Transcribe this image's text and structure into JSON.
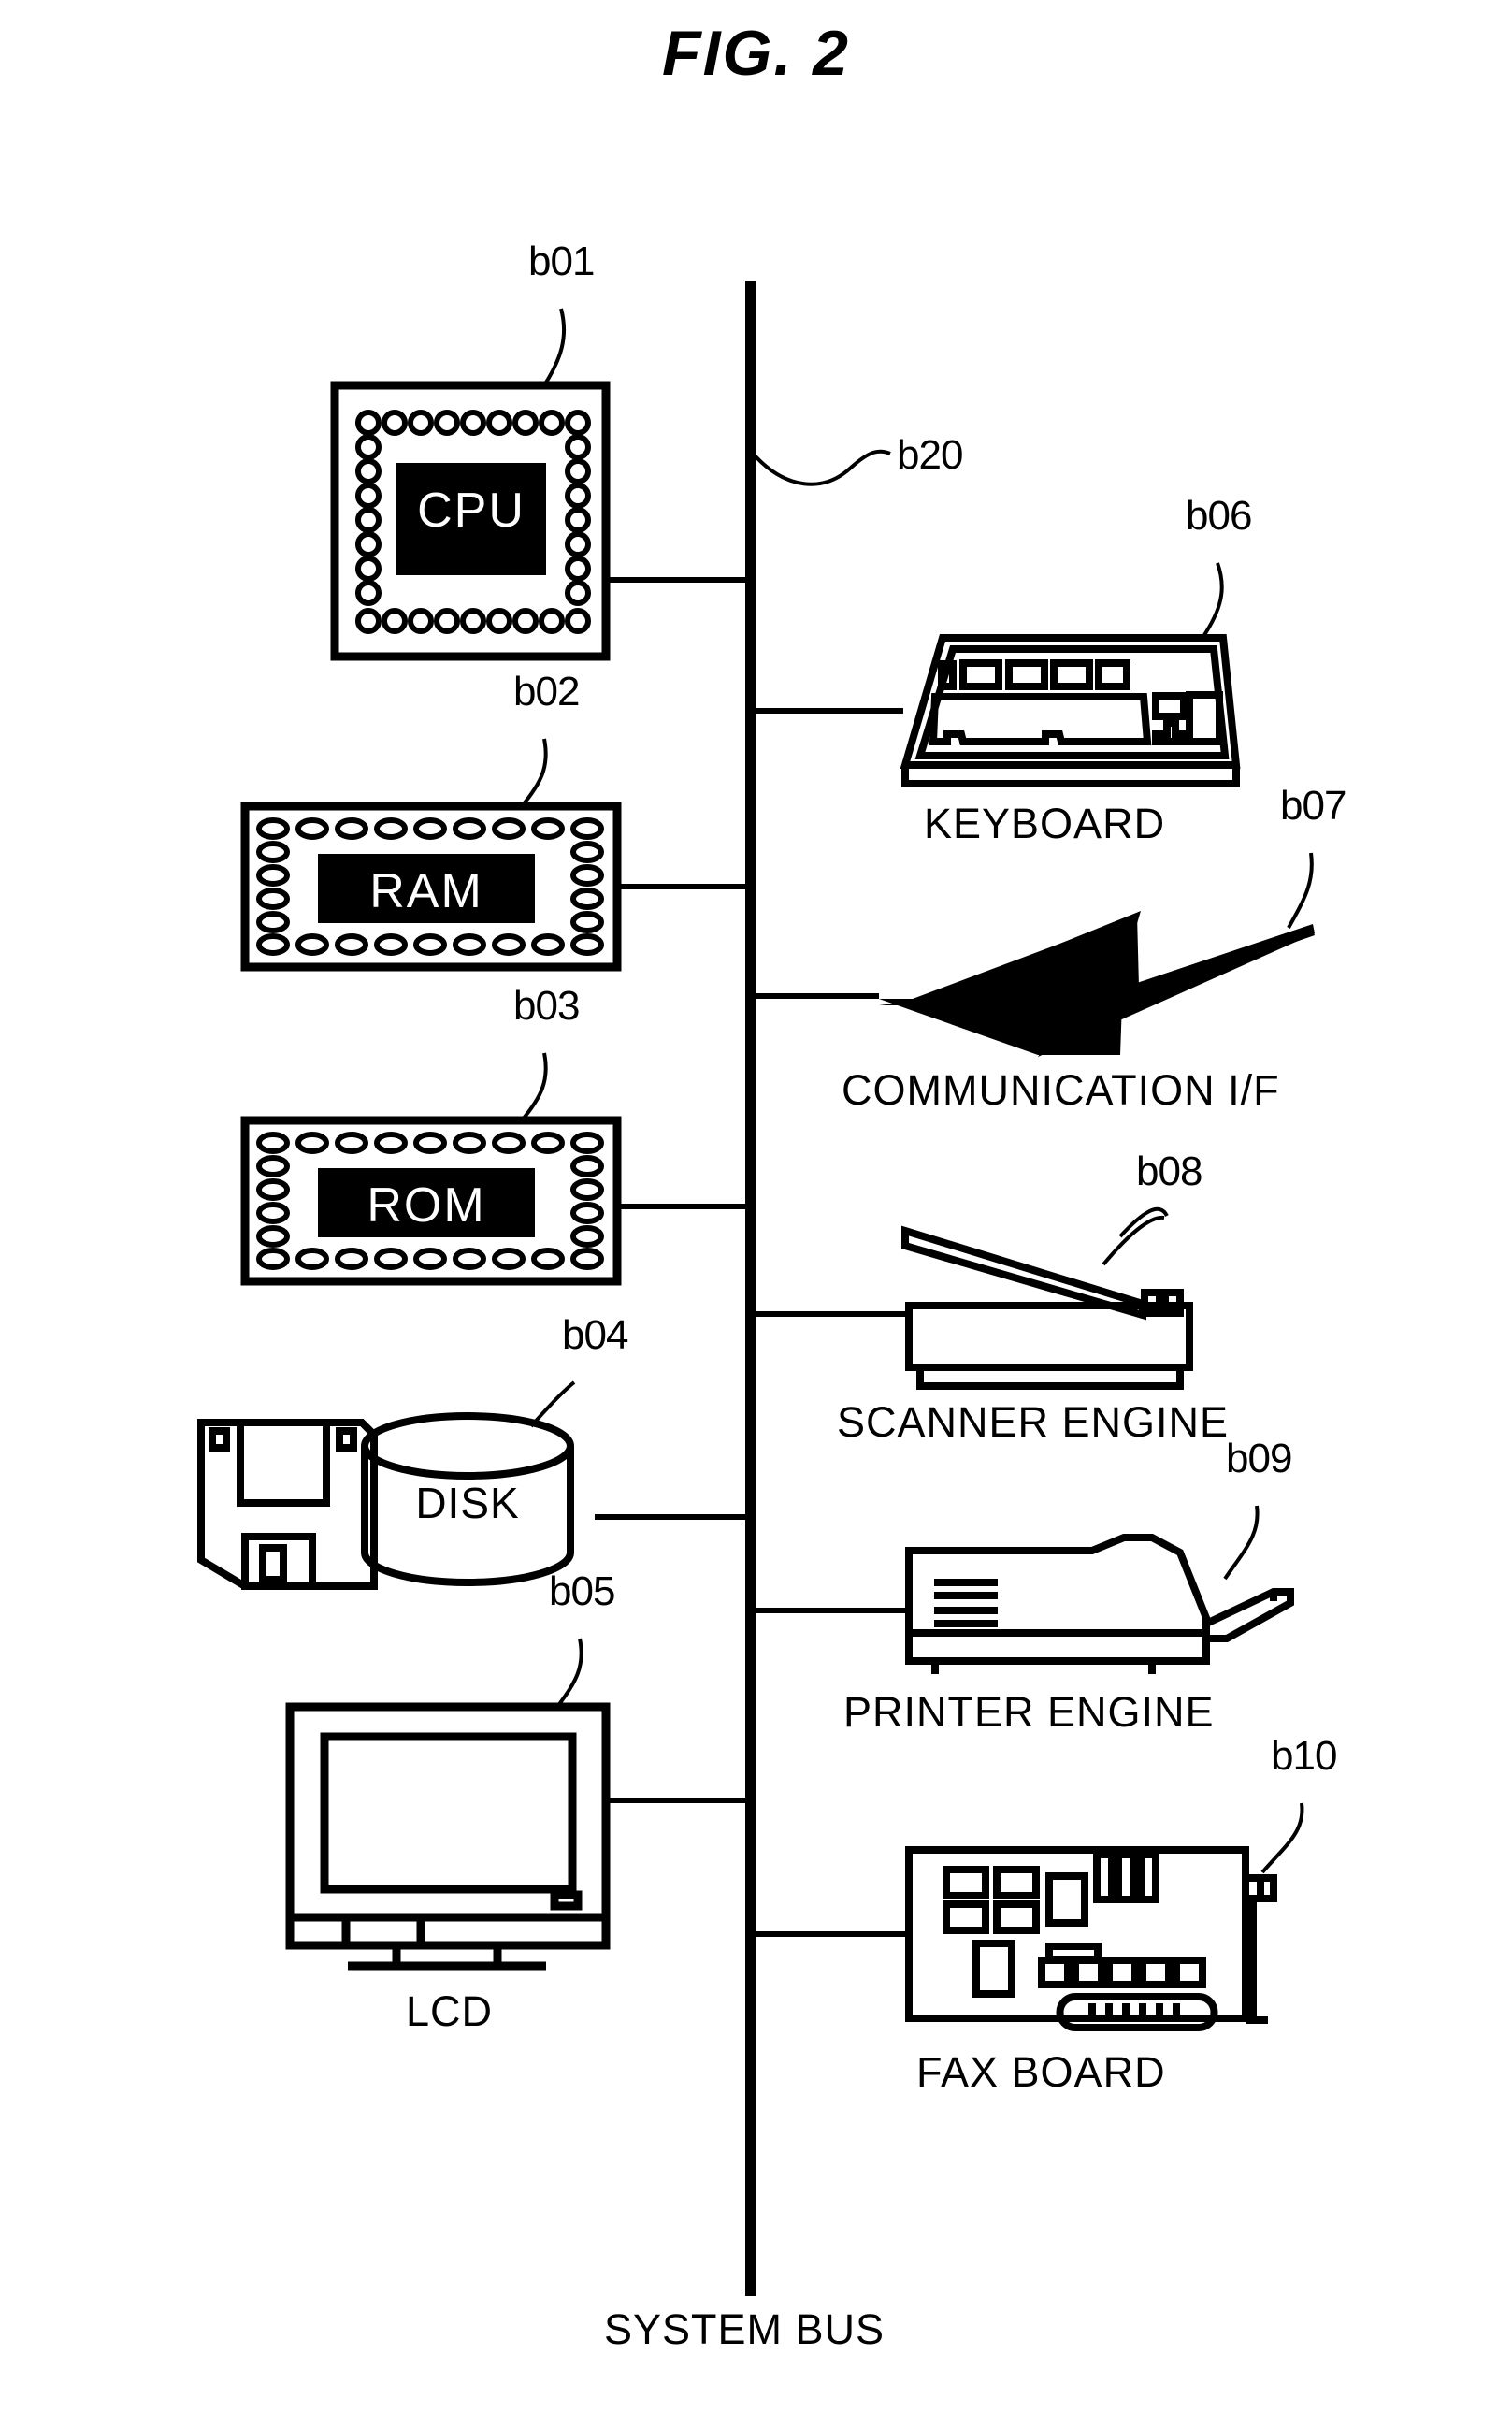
{
  "figure": {
    "title": "FIG. 2",
    "kind": "block-diagram",
    "description": "Hardware block diagram of an image processing apparatus connected to a system bus"
  },
  "bus": {
    "label": "SYSTEM BUS",
    "ref": "b20"
  },
  "components": [
    {
      "id": "cpu",
      "ref": "b01",
      "label": "CPU",
      "label_position": "inside",
      "icon": "cpu-chip-icon",
      "side": "left"
    },
    {
      "id": "ram",
      "ref": "b02",
      "label": "RAM",
      "label_position": "inside",
      "icon": "memory-module-icon",
      "side": "left"
    },
    {
      "id": "rom",
      "ref": "b03",
      "label": "ROM",
      "label_position": "inside",
      "icon": "memory-module-icon",
      "side": "left"
    },
    {
      "id": "disk",
      "ref": "b04",
      "label": "DISK",
      "label_position": "inside",
      "icon": "disk-cylinder-icon",
      "side": "left"
    },
    {
      "id": "lcd",
      "ref": "b05",
      "label": "LCD",
      "label_position": "below",
      "icon": "monitor-icon",
      "side": "left"
    },
    {
      "id": "keyboard",
      "ref": "b06",
      "label": "KEYBOARD",
      "label_position": "below",
      "icon": "keyboard-icon",
      "side": "right"
    },
    {
      "id": "communication-if",
      "ref": "b07",
      "label": "COMMUNICATION I/F",
      "label_position": "below",
      "icon": "lightning-bolt-icon",
      "side": "right"
    },
    {
      "id": "scanner-engine",
      "ref": "b08",
      "label": "SCANNER ENGINE",
      "label_position": "below",
      "icon": "scanner-icon",
      "side": "right"
    },
    {
      "id": "printer-engine",
      "ref": "b09",
      "label": "PRINTER ENGINE",
      "label_position": "below",
      "icon": "printer-icon",
      "side": "right"
    },
    {
      "id": "fax-board",
      "ref": "b10",
      "label": "FAX BOARD",
      "label_position": "below",
      "icon": "expansion-card-icon",
      "side": "right"
    }
  ],
  "decorations": {
    "floppy_icon": "floppy-disk-icon"
  },
  "colors": {
    "ink": "#000000",
    "paper": "#ffffff",
    "chip_fill": "#000000",
    "chip_text": "#ffffff"
  }
}
